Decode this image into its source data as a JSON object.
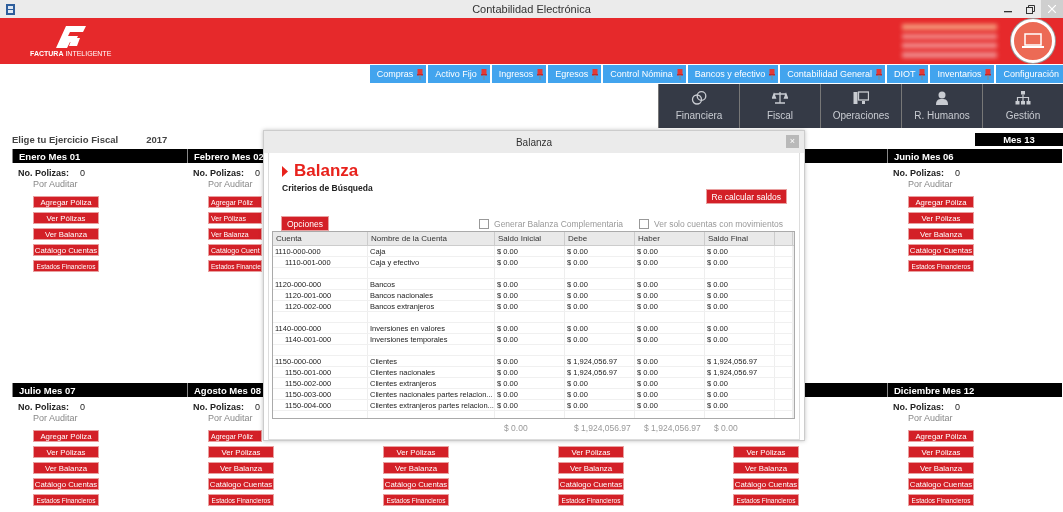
{
  "window": {
    "title": "Contabilidad Electrónica"
  },
  "banner": {
    "logo_text": "FACTURA",
    "logo_text_2": "INTELIGENTE"
  },
  "menu": [
    {
      "label": "Compras",
      "pinned": true
    },
    {
      "label": "Activo Fijo",
      "pinned": true
    },
    {
      "label": "Ingresos",
      "pinned": true
    },
    {
      "label": "Egresos",
      "pinned": true
    },
    {
      "label": "Control Nómina",
      "pinned": true
    },
    {
      "label": "Bancos y efectivo",
      "pinned": true
    },
    {
      "label": "Contabilidad General",
      "pinned": true
    },
    {
      "label": "DIOT",
      "pinned": true
    },
    {
      "label": "Inventarios",
      "pinned": true
    },
    {
      "label": "Configuración",
      "pinned": false
    }
  ],
  "modules": [
    {
      "kind": "coins",
      "label": "Financiera"
    },
    {
      "kind": "scales",
      "label": "Fiscal"
    },
    {
      "kind": "monitor",
      "label": "Operaciones"
    },
    {
      "kind": "person",
      "label": "R. Humanos"
    },
    {
      "kind": "org",
      "label": "Gestión"
    }
  ],
  "fiscal_year": {
    "label": "Elige tu Ejercicio Fiscal",
    "value": "2017",
    "extra_month": "Mes 13"
  },
  "months_top": [
    {
      "title": "Enero Mes 01",
      "count_label": "No. Polizas:",
      "count": "0",
      "status": "Por Auditar",
      "buttons": [
        "Agregar Póliza",
        "Ver Pólizas",
        "Ver Balanza",
        "Catálogo Cuentas",
        "Estados Financieros"
      ]
    },
    {
      "title": "Febrero Mes 02",
      "count_label": "No. Polizas:",
      "count": "0",
      "status": "Por Auditar",
      "buttons": [
        "Agregar Póliz",
        "Ver Pólizas",
        "Ver Balanza",
        "Catálogo Cuent",
        "Estados Financie"
      ]
    },
    {
      "title": "Junio Mes 06",
      "count_label": "No. Polizas:",
      "count": "0",
      "status": "Por Auditar",
      "buttons": [
        "Agregar Póliza",
        "Ver Pólizas",
        "Ver Balanza",
        "Catálogo Cuentas",
        "Estados Financieros"
      ]
    }
  ],
  "months_bottom": [
    {
      "title": "Julio Mes 07",
      "count_label": "No. Polizas:",
      "count": "0",
      "status": "Por Auditar",
      "buttons": [
        "Agregar Póliza",
        "Ver Pólizas",
        "Ver Balanza",
        "Catálogo Cuentas",
        "Estados Financieros"
      ]
    },
    {
      "title": "Agosto Mes 08",
      "count_label": "No. Polizas:",
      "count": "0",
      "status": "Por Auditar",
      "buttons": [
        "Agregar Póliz",
        "Ver Pólizas",
        "Ver Balanza",
        "Catálogo Cuentas",
        "Estados Financieros"
      ]
    },
    {
      "buttons": [
        "Ver Pólizas",
        "Ver Balanza",
        "Catálogo Cuentas",
        "Estados Financieros"
      ]
    },
    {
      "buttons": [
        "Ver Pólizas",
        "Ver Balanza",
        "Catálogo Cuentas",
        "Estados Financieros"
      ]
    },
    {
      "buttons": [
        "Ver Pólizas",
        "Ver Balanza",
        "Catálogo Cuentas",
        "Estados Financieros"
      ]
    },
    {
      "title": "Diciembre Mes 12",
      "count_label": "No. Polizas:",
      "count": "0",
      "status": "Por Auditar",
      "buttons": [
        "Agregar Póliza",
        "Ver Pólizas",
        "Ver Balanza",
        "Catálogo Cuentas",
        "Estados Financieros"
      ]
    }
  ],
  "dialog": {
    "title": "Balanza",
    "close": "×",
    "heading": "Balanza",
    "subheading": "Criterios de Búsqueda",
    "recalc_button": "Re calcular saldos",
    "options_button": "Opciones",
    "checkboxes": [
      {
        "label": "Generar Balanza Complementaria",
        "checked": false
      },
      {
        "label": "Ver solo cuentas con movimientos",
        "checked": false
      }
    ],
    "table": {
      "columns": [
        "Cuenta",
        "Nombre de la Cuenta",
        "Saldo Inicial",
        "Debe",
        "Haber",
        "Saldo Final"
      ],
      "rows": [
        {
          "cells": [
            "1110-000-000",
            "Caja",
            "$ 0.00",
            "$ 0.00",
            "$ 0.00",
            "$ 0.00"
          ],
          "children": [
            {
              "cells": [
                "1110-001-000",
                "Caja y efectivo",
                "$ 0.00",
                "$ 0.00",
                "$ 0.00",
                "$ 0.00"
              ]
            }
          ]
        },
        {
          "cells": [
            "1120-000-000",
            "Bancos",
            "$ 0.00",
            "$ 0.00",
            "$ 0.00",
            "$ 0.00"
          ],
          "children": [
            {
              "cells": [
                "1120-001-000",
                "Bancos nacionales",
                "$ 0.00",
                "$ 0.00",
                "$ 0.00",
                "$ 0.00"
              ]
            },
            {
              "cells": [
                "1120-002-000",
                "Bancos extranjeros",
                "$ 0.00",
                "$ 0.00",
                "$ 0.00",
                "$ 0.00"
              ]
            }
          ]
        },
        {
          "cells": [
            "1140-000-000",
            "Inversiones en valores",
            "$ 0.00",
            "$ 0.00",
            "$ 0.00",
            "$ 0.00"
          ],
          "children": [
            {
              "cells": [
                "1140-001-000",
                "Inversiones temporales",
                "$ 0.00",
                "$ 0.00",
                "$ 0.00",
                "$ 0.00"
              ]
            }
          ]
        },
        {
          "cells": [
            "1150-000-000",
            "Clientes",
            "$ 0.00",
            "$ 1,924,056.97",
            "$ 0.00",
            "$ 1,924,056.97"
          ],
          "children": [
            {
              "cells": [
                "1150-001-000",
                "Clientes nacionales",
                "$ 0.00",
                "$ 1,924,056.97",
                "$ 0.00",
                "$ 1,924,056.97"
              ]
            },
            {
              "cells": [
                "1150-002-000",
                "Clientes extranjeros",
                "$ 0.00",
                "$ 0.00",
                "$ 0.00",
                "$ 0.00"
              ]
            },
            {
              "cells": [
                "1150-003-000",
                "Clientes nacionales partes relacion...",
                "$ 0.00",
                "$ 0.00",
                "$ 0.00",
                "$ 0.00"
              ]
            },
            {
              "cells": [
                "1150-004-000",
                "Clientes extranjeros partes relacion...",
                "$ 0.00",
                "$ 0.00",
                "$ 0.00",
                "$ 0.00"
              ]
            }
          ]
        }
      ],
      "totals": [
        "$ 0.00",
        "$ 1,924,056.97",
        "$ 1,924,056.97",
        "$ 0.00"
      ]
    }
  }
}
